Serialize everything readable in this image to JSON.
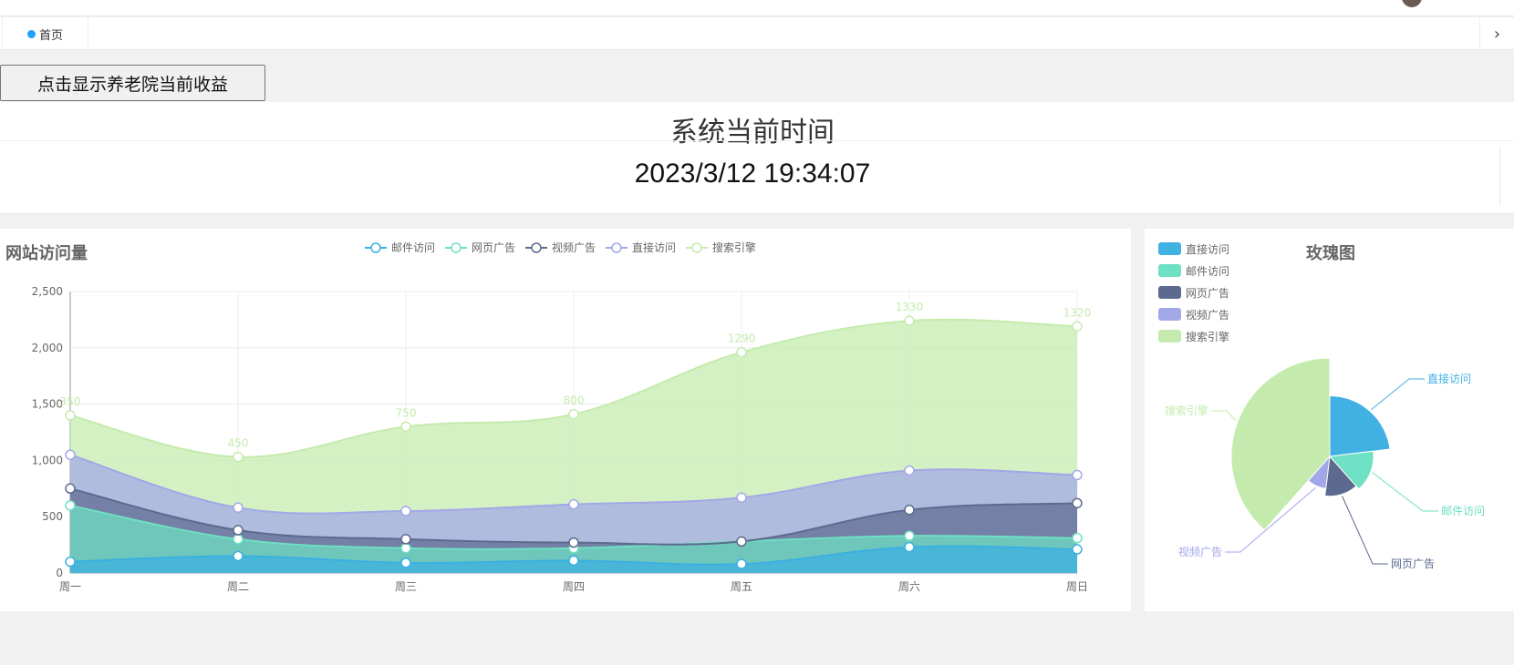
{
  "tabs": {
    "home_label": "首页",
    "next_icon": "›"
  },
  "income_button": {
    "label": "点击显示养老院当前收益"
  },
  "system_time": {
    "title": "系统当前时间",
    "value": "2023/3/12 19:34:07"
  },
  "visits_chart": {
    "title": "网站访问量"
  },
  "rose_chart": {
    "title": "玫瑰图"
  },
  "chart_data": [
    {
      "type": "area",
      "title": "网站访问量",
      "stacked": true,
      "smooth": true,
      "categories": [
        "周一",
        "周二",
        "周三",
        "周四",
        "周五",
        "周六",
        "周日"
      ],
      "ylim": [
        0,
        2500
      ],
      "yticks": [
        0,
        500,
        1000,
        1500,
        2000,
        2500
      ],
      "grid": true,
      "legend_position": "top-center",
      "series": [
        {
          "name": "邮件访问",
          "color": "#3ab0e2",
          "values": [
            100,
            150,
            90,
            110,
            80,
            230,
            210
          ]
        },
        {
          "name": "网页广告",
          "color": "#6ee0c3",
          "values": [
            500,
            150,
            130,
            110,
            200,
            100,
            100
          ]
        },
        {
          "name": "视频广告",
          "color": "#5d6a8f",
          "values": [
            150,
            80,
            80,
            50,
            0,
            230,
            310
          ]
        },
        {
          "name": "直接访问",
          "color": "#a2a7e8",
          "values": [
            300,
            200,
            250,
            340,
            390,
            350,
            250
          ]
        },
        {
          "name": "搜索引擎",
          "color": "#c4ebad",
          "values": [
            350,
            450,
            750,
            800,
            1290,
            1330,
            1320
          ],
          "show_labels": true
        }
      ]
    },
    {
      "type": "pie",
      "subtype": "rose",
      "title": "玫瑰图",
      "legend_position": "top-left",
      "series": [
        {
          "name": "直接访问",
          "color": "#41b0e2",
          "value": 60
        },
        {
          "name": "邮件访问",
          "color": "#6ee0c3",
          "value": 40
        },
        {
          "name": "网页广告",
          "color": "#5d6a8f",
          "value": 35
        },
        {
          "name": "视频广告",
          "color": "#a2a7e8",
          "value": 25
        },
        {
          "name": "搜索引擎",
          "color": "#c4ebad",
          "value": 100
        }
      ]
    }
  ]
}
